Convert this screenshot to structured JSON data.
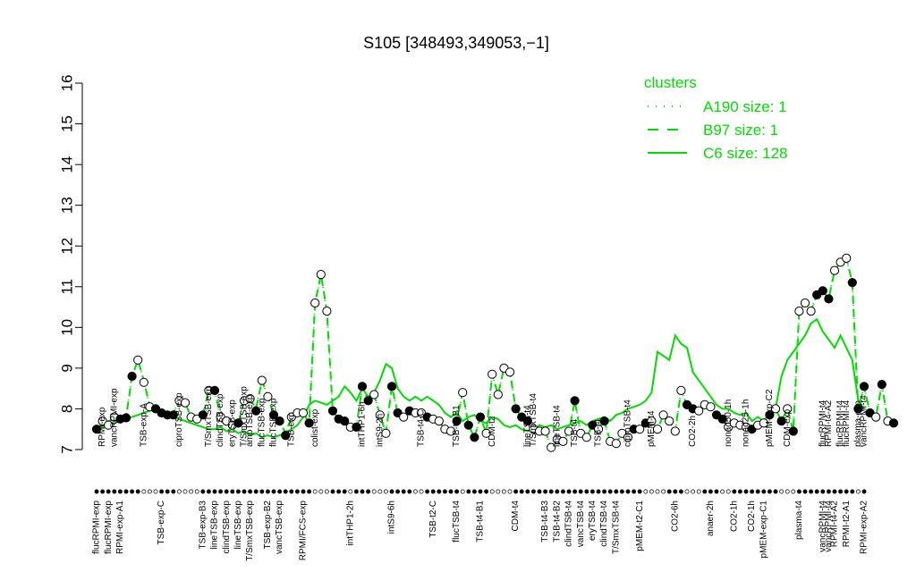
{
  "chart_data": {
    "type": "line",
    "title": "S105 [348493,349053,−1]",
    "xlabel": "",
    "ylabel": "",
    "ylim": [
      7,
      16
    ],
    "yticks": [
      7,
      8,
      9,
      10,
      11,
      12,
      13,
      14,
      15,
      16
    ],
    "n_points": 131,
    "colors": {
      "line": "#00dd00",
      "point_fill": "#000000",
      "open_fill": "#ffffff",
      "text": "#000000"
    },
    "legend": {
      "title": "clusters",
      "placement": "top-right",
      "entries": [
        {
          "label": "A190 size: 1",
          "style": "dotted"
        },
        {
          "label": "B97 size: 1",
          "style": "dashed"
        },
        {
          "label": "C6 size: 128",
          "style": "solid"
        }
      ]
    },
    "xlabels": [
      {
        "i": 1,
        "text": "flucRPMI-exp"
      },
      {
        "i": 3,
        "text": "flucRPMI-exp"
      },
      {
        "i": 5,
        "text": "RPMI-exp-A1"
      },
      {
        "i": 12,
        "text": "TSB-exp-C"
      },
      {
        "i": 19,
        "text": "TSB-exp-B3"
      },
      {
        "i": 21,
        "text": "lineTSB-exp"
      },
      {
        "i": 23,
        "text": "clindTSB-exp"
      },
      {
        "i": 25,
        "text": "lineTSB-exp"
      },
      {
        "i": 27,
        "text": "T/SmxTSB-exp"
      },
      {
        "i": 30,
        "text": "TSB-exp-B2"
      },
      {
        "i": 32,
        "text": "vancTSB-exp"
      },
      {
        "i": 36,
        "text": "RPMI/FCS-exp"
      },
      {
        "i": 44,
        "text": "intTHP1-2h"
      },
      {
        "i": 51,
        "text": "intS9-6h"
      },
      {
        "i": 58,
        "text": "TSB-t2-C"
      },
      {
        "i": 62,
        "text": "flucTSB-t4"
      },
      {
        "i": 66,
        "text": "TSB-t4-B1"
      },
      {
        "i": 72,
        "text": "CDM-t4"
      },
      {
        "i": 77,
        "text": "TSB-t4-B3"
      },
      {
        "i": 79,
        "text": "TSB-t4-B2"
      },
      {
        "i": 81,
        "text": "clindTSB-t4"
      },
      {
        "i": 83,
        "text": "vancTSB-t4"
      },
      {
        "i": 85,
        "text": "eryTSB-t4"
      },
      {
        "i": 87,
        "text": "clindTSB-t4"
      },
      {
        "i": 89,
        "text": "T/SmxTSB-t4"
      },
      {
        "i": 93,
        "text": "pMEM-t2-C1"
      },
      {
        "i": 99,
        "text": "CO2-6h"
      },
      {
        "i": 105,
        "text": "anaer-2h"
      },
      {
        "i": 109,
        "text": "CO2-1h"
      },
      {
        "i": 112,
        "text": "CO2-1h"
      },
      {
        "i": 114,
        "text": "pMEM-exp-C1"
      },
      {
        "i": 120,
        "text": "plasma-t4"
      },
      {
        "i": 124,
        "text": "vancRPMI-t4"
      },
      {
        "i": 125,
        "text": "vancRPMI-t4"
      },
      {
        "i": 126,
        "text": "RPMI-t4-A2"
      },
      {
        "i": 128,
        "text": "RPMI-t2-A1"
      },
      {
        "i": 131,
        "text": "RPMI-exp-A2"
      }
    ],
    "point_labels": [
      {
        "i": 2,
        "text": "RPMI-exp"
      },
      {
        "i": 4,
        "text": "vancRPMI-exp"
      },
      {
        "i": 9,
        "text": "TSB-exp-A"
      },
      {
        "i": 15,
        "text": "ciproTSB-exp"
      },
      {
        "i": 20,
        "text": "T/SmxTSB-exp"
      },
      {
        "i": 22,
        "text": "clindTSB-exp"
      },
      {
        "i": 24,
        "text": "eryTSB-exp"
      },
      {
        "i": 26,
        "text": "T/SmxTSB-exp"
      },
      {
        "i": 27,
        "text": "ampTSB-exp"
      },
      {
        "i": 29,
        "text": "flucTSB-exp"
      },
      {
        "i": 31,
        "text": "flucTSB-exp"
      },
      {
        "i": 34,
        "text": "TSB-exp"
      },
      {
        "i": 38,
        "text": "colist-exp"
      },
      {
        "i": 46,
        "text": "intTHP1-6h"
      },
      {
        "i": 49,
        "text": "intS9-2h"
      },
      {
        "i": 56,
        "text": "TSB-t4-C"
      },
      {
        "i": 62,
        "text": "TSB-t2-B1"
      },
      {
        "i": 68,
        "text": "CDM-t2"
      },
      {
        "i": 74,
        "text": "lineTSB-t4"
      },
      {
        "i": 75,
        "text": "T/SmxTSB-t4"
      },
      {
        "i": 79,
        "text": "lineTSB-t4"
      },
      {
        "i": 82,
        "text": "TSB-t4"
      },
      {
        "i": 86,
        "text": "TSB-t4"
      },
      {
        "i": 91,
        "text": "ciproTSB-t4"
      },
      {
        "i": 95,
        "text": "pMEM-t4"
      },
      {
        "i": 102,
        "text": "CO2-2h"
      },
      {
        "i": 108,
        "text": "nonad50-1h"
      },
      {
        "i": 111,
        "text": "nonad25-1h"
      },
      {
        "i": 115,
        "text": "pMEM-exp-C2"
      },
      {
        "i": 118,
        "text": "CDM-exp"
      },
      {
        "i": 124,
        "text": "flucRPMI-t4"
      },
      {
        "i": 125,
        "text": "RPMI-t4-A2"
      },
      {
        "i": 127,
        "text": "flucRPMI-t4"
      },
      {
        "i": 128,
        "text": "flucRPMI-t4"
      },
      {
        "i": 130,
        "text": "plasma-exp"
      },
      {
        "i": 131,
        "text": "vancRPMI-t4"
      }
    ],
    "series": [
      {
        "name": "C6 size: 128",
        "style": "solid",
        "values": [
          7.5,
          7.55,
          7.6,
          7.65,
          7.7,
          7.75,
          7.8,
          7.85,
          7.9,
          7.95,
          8.0,
          7.9,
          7.85,
          7.8,
          7.75,
          7.7,
          7.65,
          7.6,
          7.55,
          7.5,
          7.5,
          7.55,
          7.45,
          7.5,
          7.4,
          7.45,
          7.35,
          7.4,
          7.3,
          7.35,
          7.3,
          7.35,
          7.4,
          7.5,
          7.6,
          7.8,
          8.1,
          8.2,
          8.15,
          8.1,
          8.2,
          8.3,
          8.55,
          8.4,
          8.2,
          8.5,
          8.3,
          8.4,
          8.7,
          9.1,
          9.0,
          8.5,
          8.3,
          8.2,
          8.3,
          8.2,
          8.3,
          8.2,
          8.1,
          7.9,
          7.8,
          7.9,
          7.7,
          7.8,
          7.85,
          7.7,
          7.65,
          7.8,
          7.75,
          7.6,
          7.55,
          7.6,
          7.5,
          7.45,
          7.5,
          7.6,
          7.55,
          7.6,
          7.5,
          7.55,
          7.6,
          7.65,
          7.7,
          7.6,
          7.7,
          7.75,
          7.8,
          7.7,
          7.85,
          7.9,
          8.0,
          8.05,
          8.1,
          8.2,
          8.4,
          9.4,
          9.3,
          9.2,
          9.8,
          9.6,
          9.5,
          8.9,
          8.7,
          8.5,
          8.3,
          8.1,
          8.0,
          8.0,
          7.9,
          7.85,
          7.9,
          7.7,
          7.8,
          7.7,
          7.9,
          8.0,
          8.8,
          9.2,
          9.4,
          9.6,
          9.8,
          10.1,
          10.2,
          9.9,
          9.7,
          9.5,
          9.8,
          9.5,
          9.2,
          8.2,
          8.0
        ]
      },
      {
        "name": "B97 size: 1",
        "style": "dashed",
        "values": [
          7.5,
          7.6,
          7.7,
          7.75,
          7.78,
          7.8,
          8.8,
          9.2,
          8.7,
          8.05,
          7.95,
          7.9,
          7.85,
          7.9,
          8.2,
          8.15,
          7.8,
          7.75,
          7.85,
          8.45,
          8.45,
          7.8,
          7.7,
          7.6,
          7.65,
          8.2,
          8.25,
          8.0,
          8.7,
          8.3,
          7.85,
          7.7,
          7.4,
          7.8,
          7.9,
          7.9,
          7.65,
          10.6,
          11.3,
          10.4,
          7.95,
          7.75,
          7.7,
          7.55,
          7.55,
          8.55,
          8.2,
          8.35,
          7.85,
          7.4,
          8.55,
          7.9,
          7.8,
          7.95,
          7.9,
          7.9,
          7.8,
          7.75,
          7.7,
          7.5,
          7.45,
          7.7,
          8.4,
          7.6,
          7.3,
          7.8,
          7.4,
          8.85,
          8.35,
          9.0,
          8.9,
          8.0,
          7.8,
          7.7,
          7.5,
          7.45,
          7.45,
          7.05,
          7.25,
          7.2,
          7.45,
          8.2,
          7.4,
          7.3,
          7.6,
          7.5,
          7.7,
          7.2,
          7.15,
          7.4,
          7.3,
          7.5,
          7.5,
          7.65,
          7.7,
          7.5,
          7.85,
          7.7,
          7.45,
          8.45,
          8.1,
          8.0,
          7.95,
          8.1,
          8.05,
          7.85,
          7.75,
          7.55,
          7.65,
          7.6,
          7.55,
          7.5,
          7.6,
          7.65,
          7.85,
          8.0,
          7.7,
          8.0,
          7.45,
          10.4,
          10.6,
          10.4,
          10.8,
          10.9,
          10.7,
          11.4,
          11.6,
          11.7,
          11.1,
          8.0,
          8.55,
          7.9,
          7.8,
          8.6,
          7.7,
          7.65
        ]
      },
      {
        "name": "A190 size: 1",
        "style": "dotted",
        "values": [
          7.5,
          7.6,
          7.7,
          7.75,
          7.78,
          7.8,
          8.8,
          9.2,
          8.7,
          8.05,
          7.95,
          7.9,
          7.85,
          7.9,
          8.2,
          8.15,
          7.8,
          7.75,
          7.85,
          8.45,
          8.45,
          7.8,
          7.7,
          7.6,
          7.65,
          8.2,
          8.25,
          8.0,
          8.7,
          8.3,
          7.85,
          7.7,
          7.4,
          7.8,
          7.9,
          7.9,
          7.65,
          10.6,
          11.3,
          10.4,
          7.95,
          7.75,
          7.7,
          7.55,
          7.55,
          8.55,
          8.2,
          8.35,
          7.85,
          7.4,
          8.55,
          7.9,
          7.8,
          7.95,
          7.9,
          7.9,
          7.8,
          7.75,
          7.7,
          7.5,
          7.45,
          7.7,
          8.4,
          7.6,
          7.3,
          7.8,
          7.4,
          8.85,
          8.35,
          9.0,
          8.9,
          8.0,
          7.8,
          7.7,
          7.5,
          7.45,
          7.45,
          7.05,
          7.25,
          7.2,
          7.45,
          8.2,
          7.4,
          7.3,
          7.6,
          7.5,
          7.7,
          7.2,
          7.15,
          7.4,
          7.3,
          7.5,
          7.5,
          7.65,
          7.7,
          7.5,
          7.85,
          7.7,
          7.45,
          8.45,
          8.1,
          8.0,
          7.95,
          8.1,
          8.05,
          7.85,
          7.75,
          7.55,
          7.65,
          7.6,
          7.55,
          7.5,
          7.6,
          7.65,
          7.85,
          8.0,
          7.7,
          8.0,
          7.45,
          10.4,
          10.6,
          10.4,
          10.8,
          10.9,
          10.7,
          11.4,
          11.6,
          11.7,
          11.1,
          8.0,
          8.55,
          7.9,
          7.8,
          8.6,
          7.7,
          7.65
        ]
      }
    ],
    "points": {
      "y": [
        7.5,
        7.7,
        7.6,
        7.8,
        7.75,
        7.78,
        8.8,
        9.2,
        8.65,
        8.05,
        8.0,
        7.9,
        7.85,
        7.85,
        8.2,
        8.15,
        7.8,
        7.75,
        7.85,
        8.45,
        8.45,
        7.8,
        7.7,
        7.6,
        7.65,
        8.2,
        8.25,
        7.95,
        8.7,
        8.3,
        7.85,
        7.7,
        7.35,
        7.8,
        7.9,
        7.9,
        7.65,
        10.6,
        11.3,
        10.4,
        7.95,
        7.75,
        7.7,
        7.55,
        7.55,
        8.55,
        8.2,
        8.35,
        7.85,
        7.4,
        8.55,
        7.9,
        7.8,
        7.95,
        7.9,
        7.9,
        7.8,
        7.75,
        7.7,
        7.5,
        7.45,
        7.7,
        8.4,
        7.6,
        7.3,
        7.8,
        7.4,
        8.85,
        8.35,
        9.0,
        8.9,
        8.0,
        7.8,
        7.7,
        7.5,
        7.45,
        7.45,
        7.05,
        7.25,
        7.2,
        7.45,
        8.2,
        7.4,
        7.3,
        7.6,
        7.5,
        7.7,
        7.2,
        7.15,
        7.4,
        7.3,
        7.5,
        7.5,
        7.65,
        7.7,
        7.5,
        7.85,
        7.7,
        7.45,
        8.45,
        8.1,
        8.0,
        7.95,
        8.1,
        8.05,
        7.85,
        7.75,
        7.55,
        7.65,
        7.6,
        7.55,
        7.5,
        7.6,
        7.65,
        7.85,
        8.0,
        7.7,
        8.0,
        7.45,
        10.4,
        10.6,
        10.4,
        10.8,
        10.9,
        10.7,
        11.4,
        11.6,
        11.7,
        11.1,
        8.0,
        8.55,
        7.9,
        7.8,
        8.6,
        7.7,
        7.65
      ],
      "open": [
        0,
        1,
        1,
        1,
        0,
        0,
        0,
        1,
        1,
        1,
        0,
        0,
        0,
        0,
        1,
        1,
        1,
        1,
        0,
        1,
        0,
        1,
        1,
        1,
        0,
        1,
        1,
        0,
        1,
        1,
        0,
        0,
        0,
        1,
        1,
        1,
        0,
        1,
        1,
        1,
        0,
        0,
        0,
        1,
        0,
        0,
        0,
        1,
        1,
        1,
        0,
        0,
        1,
        0,
        1,
        1,
        0,
        1,
        1,
        1,
        1,
        0,
        1,
        0,
        0,
        0,
        1,
        1,
        1,
        1,
        1,
        0,
        0,
        0,
        1,
        1,
        1,
        1,
        1,
        1,
        1,
        0,
        1,
        1,
        0,
        1,
        0,
        1,
        1,
        1,
        1,
        0,
        1,
        0,
        1,
        1,
        1,
        1,
        1,
        1,
        0,
        0,
        1,
        1,
        1,
        0,
        0,
        1,
        1,
        1,
        1,
        0,
        1,
        1,
        0,
        1,
        0,
        1,
        0,
        1,
        1,
        1,
        0,
        0,
        0,
        1,
        1,
        1,
        0,
        0,
        0,
        0,
        1,
        0,
        1
      ]
    },
    "bottom_markers_filled": [
      1,
      1,
      1,
      1,
      1,
      1,
      1,
      1,
      0,
      0,
      0,
      1,
      1,
      1,
      0,
      0,
      0,
      0,
      1,
      1,
      1,
      1,
      1,
      1,
      1,
      1,
      1,
      1,
      1,
      1,
      1,
      1,
      1,
      1,
      1,
      1,
      1,
      0,
      0,
      0,
      1,
      1,
      1,
      0,
      1,
      1,
      1,
      0,
      0,
      0,
      1,
      1,
      1,
      1,
      0,
      0,
      1,
      1,
      1,
      1,
      1,
      1,
      0,
      1,
      1,
      1,
      1,
      0,
      0,
      0,
      0,
      1,
      1,
      1,
      1,
      1,
      1,
      1,
      1,
      1,
      1,
      1,
      1,
      1,
      1,
      1,
      1,
      1,
      1,
      1,
      1,
      1,
      1,
      0,
      0,
      0,
      0,
      1,
      1,
      1,
      0,
      0,
      0,
      1,
      1,
      1,
      0,
      0,
      1,
      1,
      1,
      1,
      1,
      1,
      1,
      1,
      0,
      0,
      0,
      1,
      1,
      1,
      1,
      1,
      1,
      1,
      1,
      1,
      1,
      0,
      1
    ]
  }
}
